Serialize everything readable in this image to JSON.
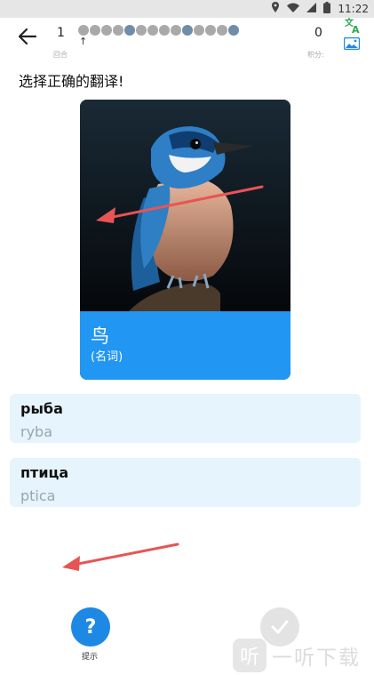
{
  "status_bar": {
    "time": "11:22"
  },
  "header": {
    "round_number": "1",
    "round_label": "回合",
    "score_number": "0",
    "score_label": "积分:",
    "progress_dots": [
      "done",
      "done",
      "done",
      "done",
      "current",
      "done",
      "done",
      "done",
      "done",
      "current",
      "done",
      "done",
      "done",
      "current"
    ],
    "progress_marker": "↑"
  },
  "prompt": "选择正确的翻译!",
  "card": {
    "word": "鸟",
    "part_of_speech": "(名词)",
    "caption_color": "#2196f3"
  },
  "options": [
    {
      "word": "рыба",
      "romanization": "ryba"
    },
    {
      "word": "птица",
      "romanization": "ptica"
    }
  ],
  "hint": {
    "icon": "?",
    "label": "提示"
  },
  "watermark": {
    "badge": "听",
    "text": "一听下载"
  },
  "colors": {
    "accent": "#1e88e5",
    "option_bg": "#e5f4fd",
    "annotation": "#e85454"
  }
}
